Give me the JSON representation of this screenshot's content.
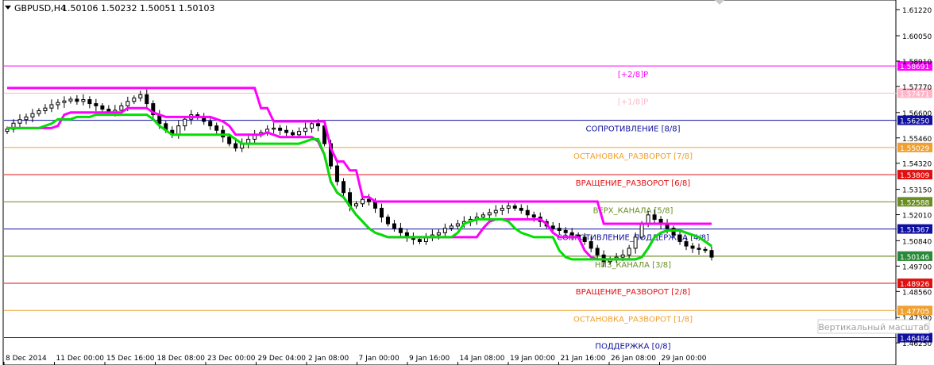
{
  "header": {
    "symbol_label": "GBPUSD,H4",
    "ohlc_label": "1.50106 1.50232 1.50051 1.50103"
  },
  "tooltip": "Вертикальный масштаб",
  "colors": {
    "background": "#ffffff",
    "candles": "#000000",
    "magenta_line": "#ff00ff",
    "green_line": "#00e000",
    "axis": "#000000",
    "current_price_tag": "#2a8a3a"
  },
  "chart_data": {
    "type": "candlestick",
    "symbol": "GBPUSD",
    "timeframe": "H4",
    "ylim": [
      1.4604,
      1.6137
    ],
    "grid": false,
    "y_ticks": [
      "1.61220",
      "1.60050",
      "1.58910",
      "1.57770",
      "1.56600",
      "1.55460",
      "1.54320",
      "1.53150",
      "1.52010",
      "1.50840",
      "1.49700",
      "1.48560",
      "1.47390",
      "1.46250"
    ],
    "x_ticks": [
      "8 Dec 2014",
      "11 Dec 00:00",
      "15 Dec 16:00",
      "18 Dec 08:00",
      "23 Dec 00:00",
      "29 Dec 04:00",
      "2 Jan 08:00",
      "7 Jan 00:00",
      "9 Jan 16:00",
      "14 Jan 08:00",
      "19 Jan 00:00",
      "21 Jan 16:00",
      "26 Jan 08:00",
      "29 Jan 00:00"
    ],
    "current_price": "1.50146",
    "levels": [
      {
        "label": "[+2/8]P",
        "price": "1.58691",
        "color": "#ff00ff"
      },
      {
        "label": "[+1/8]P",
        "price": "1.57471",
        "color": "#ffb6c8"
      },
      {
        "label": "СОПРОТИВЛЕНИЕ [8/8]",
        "price": "1.56250",
        "color": "#1010a0"
      },
      {
        "label": "ОСТАНОВКА_РАЗВОРОТ [7/8]",
        "price": "1.55029",
        "color": "#f0a030"
      },
      {
        "label": "ВРАЩЕНИЕ_РАЗВОРОТ [6/8]",
        "price": "1.53809",
        "color": "#e01010"
      },
      {
        "label": "ВЕРХ_КАНАЛА [5/8]",
        "price": "1.52588",
        "color": "#6b8e23"
      },
      {
        "label": "СОПРОТИВЛЕНИЕ_ПОДДЕРЖКА [4/8]",
        "price": "1.51367",
        "color": "#1010a0"
      },
      {
        "label": "НИЗ_КАНАЛА [3/8]",
        "price": "1.50146",
        "color": "#6b8e23"
      },
      {
        "label": "ВРАЩЕНИЕ_РАЗВОРОТ [2/8]",
        "price": "1.48926",
        "color": "#e01010"
      },
      {
        "label": "ОСТАНОВКА_РАЗВОРОТ [1/8]",
        "price": "1.47705",
        "color": "#f0a030"
      },
      {
        "label": "ПОДДЕРЖКА [0/8]",
        "price": "1.46484",
        "color": "#1010a0"
      }
    ],
    "series": [
      {
        "kind": "candles",
        "close": [
          1.5585,
          1.5612,
          1.5628,
          1.564,
          1.5655,
          1.5668,
          1.568,
          1.5695,
          1.5705,
          1.5712,
          1.572,
          1.571,
          1.5718,
          1.57,
          1.569,
          1.5675,
          1.566,
          1.567,
          1.569,
          1.571,
          1.5725,
          1.574,
          1.57,
          1.565,
          1.561,
          1.558,
          1.556,
          1.56,
          1.563,
          1.565,
          1.564,
          1.562,
          1.56,
          1.558,
          1.555,
          1.552,
          1.55,
          1.552,
          1.554,
          1.556,
          1.557,
          1.5585,
          1.559,
          1.558,
          1.557,
          1.556,
          1.5575,
          1.559,
          1.561,
          1.56,
          1.552,
          1.542,
          1.535,
          1.53,
          1.524,
          1.525,
          1.527,
          1.526,
          1.523,
          1.519,
          1.516,
          1.514,
          1.512,
          1.51,
          1.509,
          1.508,
          1.51,
          1.511,
          1.512,
          1.514,
          1.515,
          1.516,
          1.517,
          1.518,
          1.519,
          1.52,
          1.521,
          1.522,
          1.523,
          1.524,
          1.523,
          1.522,
          1.52,
          1.519,
          1.517,
          1.515,
          1.514,
          1.513,
          1.512,
          1.511,
          1.51,
          1.508,
          1.505,
          1.502,
          1.499,
          1.5,
          1.501,
          1.502,
          1.505,
          1.51,
          1.516,
          1.52,
          1.518,
          1.516,
          1.514,
          1.511,
          1.508,
          1.506,
          1.505,
          1.5045,
          1.504,
          1.501
        ]
      },
      {
        "kind": "line",
        "color": "#ff00ff",
        "values": [
          1.577,
          1.577,
          1.577,
          1.577,
          1.577,
          1.577,
          1.577,
          1.577,
          1.577,
          1.577,
          1.577,
          1.577,
          1.577,
          1.577,
          1.577,
          1.577,
          1.577,
          1.577,
          1.577,
          1.577,
          1.577,
          1.577,
          1.577,
          1.577,
          1.577,
          1.577,
          1.577,
          1.577,
          1.577,
          1.577,
          1.577,
          1.577,
          1.577,
          1.577,
          1.577,
          1.577,
          1.577,
          1.577,
          1.577,
          1.577,
          1.568,
          1.568,
          1.562,
          1.562,
          1.562,
          1.562,
          1.562,
          1.562,
          1.562,
          1.562,
          1.562,
          1.55,
          1.544,
          1.544,
          1.54,
          1.54,
          1.528,
          1.528,
          1.526,
          1.526,
          1.526,
          1.526,
          1.526,
          1.526,
          1.526,
          1.526,
          1.526,
          1.526,
          1.526,
          1.526,
          1.526,
          1.526,
          1.526,
          1.526,
          1.526,
          1.526,
          1.526,
          1.526,
          1.526,
          1.526,
          1.526,
          1.526,
          1.526,
          1.526,
          1.526,
          1.526,
          1.526,
          1.526,
          1.526,
          1.526,
          1.526,
          1.526,
          1.526,
          1.526,
          1.516,
          1.516,
          1.516,
          1.516,
          1.516,
          1.516,
          1.516,
          1.516,
          1.516,
          1.516,
          1.516,
          1.516,
          1.516,
          1.516,
          1.516,
          1.516,
          1.516,
          1.516
        ]
      },
      {
        "kind": "line",
        "color": "#ff00ff",
        "values": [
          1.559,
          1.559,
          1.559,
          1.559,
          1.559,
          1.559,
          1.559,
          1.559,
          1.56,
          1.565,
          1.566,
          1.566,
          1.566,
          1.566,
          1.566,
          1.566,
          1.566,
          1.566,
          1.566,
          1.568,
          1.568,
          1.568,
          1.568,
          1.566,
          1.565,
          1.564,
          1.564,
          1.564,
          1.564,
          1.564,
          1.564,
          1.564,
          1.564,
          1.563,
          1.562,
          1.56,
          1.556,
          1.556,
          1.556,
          1.556,
          1.556,
          1.557,
          1.556,
          1.555,
          1.555,
          1.555,
          1.555,
          1.555,
          1.555,
          1.553,
          1.547,
          1.535,
          1.53,
          1.528,
          1.524,
          1.52,
          1.517,
          1.514,
          1.512,
          1.511,
          1.51,
          1.51,
          1.51,
          1.51,
          1.51,
          1.51,
          1.51,
          1.51,
          1.51,
          1.51,
          1.51,
          1.51,
          1.51,
          1.51,
          1.51,
          1.514,
          1.517,
          1.518,
          1.518,
          1.518,
          1.518,
          1.518,
          1.518,
          1.518,
          1.518,
          1.516,
          1.512,
          1.51,
          1.51,
          1.51,
          1.51,
          1.504,
          1.501,
          1.5,
          1.5,
          1.5,
          1.5,
          1.5,
          1.5,
          1.5,
          1.501,
          1.505,
          1.51,
          1.512,
          1.513,
          1.513,
          1.513,
          1.512,
          1.511,
          1.51,
          1.508,
          1.506
        ]
      },
      {
        "kind": "line",
        "color": "#00e000",
        "values": [
          1.559,
          1.559,
          1.559,
          1.559,
          1.559,
          1.559,
          1.56,
          1.561,
          1.563,
          1.563,
          1.563,
          1.564,
          1.564,
          1.564,
          1.565,
          1.565,
          1.565,
          1.565,
          1.565,
          1.565,
          1.565,
          1.565,
          1.565,
          1.563,
          1.56,
          1.558,
          1.556,
          1.556,
          1.556,
          1.556,
          1.556,
          1.556,
          1.556,
          1.556,
          1.556,
          1.556,
          1.554,
          1.552,
          1.552,
          1.552,
          1.552,
          1.552,
          1.552,
          1.552,
          1.552,
          1.552,
          1.552,
          1.553,
          1.554,
          1.554,
          1.547,
          1.535,
          1.53,
          1.528,
          1.524,
          1.52,
          1.517,
          1.514,
          1.512,
          1.511,
          1.51,
          1.51,
          1.51,
          1.51,
          1.51,
          1.51,
          1.51,
          1.51,
          1.51,
          1.51,
          1.51,
          1.512,
          1.516,
          1.517,
          1.518,
          1.518,
          1.518,
          1.518,
          1.518,
          1.517,
          1.514,
          1.512,
          1.511,
          1.51,
          1.51,
          1.51,
          1.51,
          1.504,
          1.501,
          1.5,
          1.5,
          1.5,
          1.5,
          1.5,
          1.5,
          1.5,
          1.5,
          1.5,
          1.5,
          1.5,
          1.501,
          1.505,
          1.51,
          1.512,
          1.513,
          1.513,
          1.513,
          1.512,
          1.511,
          1.51,
          1.508,
          1.506
        ]
      }
    ]
  }
}
